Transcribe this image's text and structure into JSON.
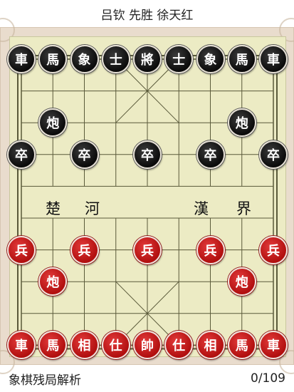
{
  "title": "吕钦 先胜 徐天红",
  "river": {
    "left_1": "楚",
    "left_2": "河",
    "right_1": "漢",
    "right_2": "界"
  },
  "colors": {
    "board": "#ecebc4",
    "frame": "#e9dccd",
    "line": "#5a5a3a",
    "black_piece": "#111111",
    "red_piece": "#c21a1a"
  },
  "pieces": [
    {
      "label": "車",
      "side": "black",
      "file": 0,
      "rank": 0
    },
    {
      "label": "馬",
      "side": "black",
      "file": 1,
      "rank": 0
    },
    {
      "label": "象",
      "side": "black",
      "file": 2,
      "rank": 0
    },
    {
      "label": "士",
      "side": "black",
      "file": 3,
      "rank": 0
    },
    {
      "label": "將",
      "side": "black",
      "file": 4,
      "rank": 0
    },
    {
      "label": "士",
      "side": "black",
      "file": 5,
      "rank": 0
    },
    {
      "label": "象",
      "side": "black",
      "file": 6,
      "rank": 0
    },
    {
      "label": "馬",
      "side": "black",
      "file": 7,
      "rank": 0
    },
    {
      "label": "車",
      "side": "black",
      "file": 8,
      "rank": 0
    },
    {
      "label": "炮",
      "side": "black",
      "file": 1,
      "rank": 2
    },
    {
      "label": "炮",
      "side": "black",
      "file": 7,
      "rank": 2
    },
    {
      "label": "卒",
      "side": "black",
      "file": 0,
      "rank": 3
    },
    {
      "label": "卒",
      "side": "black",
      "file": 2,
      "rank": 3
    },
    {
      "label": "卒",
      "side": "black",
      "file": 4,
      "rank": 3
    },
    {
      "label": "卒",
      "side": "black",
      "file": 6,
      "rank": 3
    },
    {
      "label": "卒",
      "side": "black",
      "file": 8,
      "rank": 3
    },
    {
      "label": "兵",
      "side": "red",
      "file": 0,
      "rank": 6
    },
    {
      "label": "兵",
      "side": "red",
      "file": 2,
      "rank": 6
    },
    {
      "label": "兵",
      "side": "red",
      "file": 4,
      "rank": 6
    },
    {
      "label": "兵",
      "side": "red",
      "file": 6,
      "rank": 6
    },
    {
      "label": "兵",
      "side": "red",
      "file": 8,
      "rank": 6
    },
    {
      "label": "炮",
      "side": "red",
      "file": 1,
      "rank": 7
    },
    {
      "label": "炮",
      "side": "red",
      "file": 7,
      "rank": 7
    },
    {
      "label": "車",
      "side": "red",
      "file": 0,
      "rank": 9
    },
    {
      "label": "馬",
      "side": "red",
      "file": 1,
      "rank": 9
    },
    {
      "label": "相",
      "side": "red",
      "file": 2,
      "rank": 9
    },
    {
      "label": "仕",
      "side": "red",
      "file": 3,
      "rank": 9
    },
    {
      "label": "帥",
      "side": "red",
      "file": 4,
      "rank": 9
    },
    {
      "label": "仕",
      "side": "red",
      "file": 5,
      "rank": 9
    },
    {
      "label": "相",
      "side": "red",
      "file": 6,
      "rank": 9
    },
    {
      "label": "馬",
      "side": "red",
      "file": 7,
      "rank": 9
    },
    {
      "label": "車",
      "side": "red",
      "file": 8,
      "rank": 9
    }
  ],
  "footer": {
    "app_name": "象棋残局解析",
    "move_counter": "0/109"
  }
}
